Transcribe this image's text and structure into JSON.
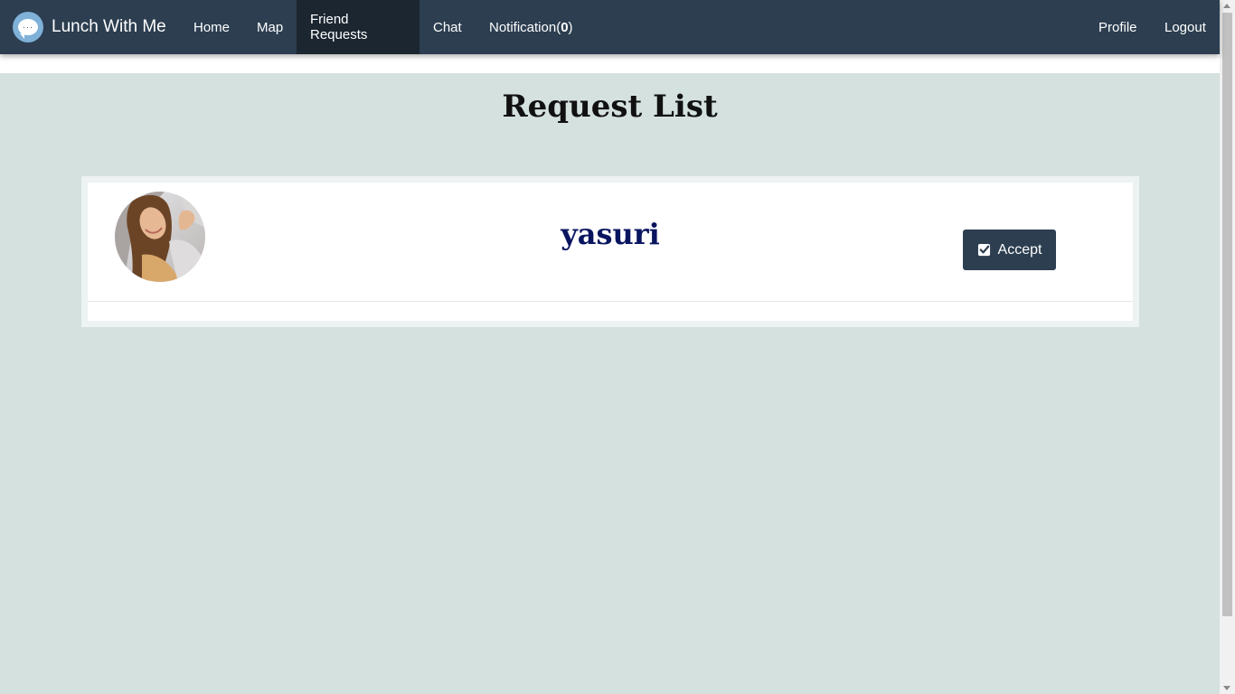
{
  "app": {
    "brand_name": "Lunch With Me",
    "brand_logo_glyph": "···"
  },
  "nav": {
    "home": "Home",
    "map": "Map",
    "friend_requests": "Friend Requests",
    "chat": "Chat",
    "notification_label": "Notification(",
    "notification_count": "0",
    "notification_close": ")",
    "profile": "Profile",
    "logout": "Logout",
    "active": "Friend Requests"
  },
  "main": {
    "title": "Request List",
    "requests": [
      {
        "name": "yasuri",
        "accept_label": "Accept"
      }
    ]
  },
  "colors": {
    "navbar_bg": "#2c3e50",
    "navbar_active": "#1b2631",
    "page_bg": "#d4e1df",
    "name_color": "#0a1560",
    "button_bg": "#2c3e50"
  }
}
